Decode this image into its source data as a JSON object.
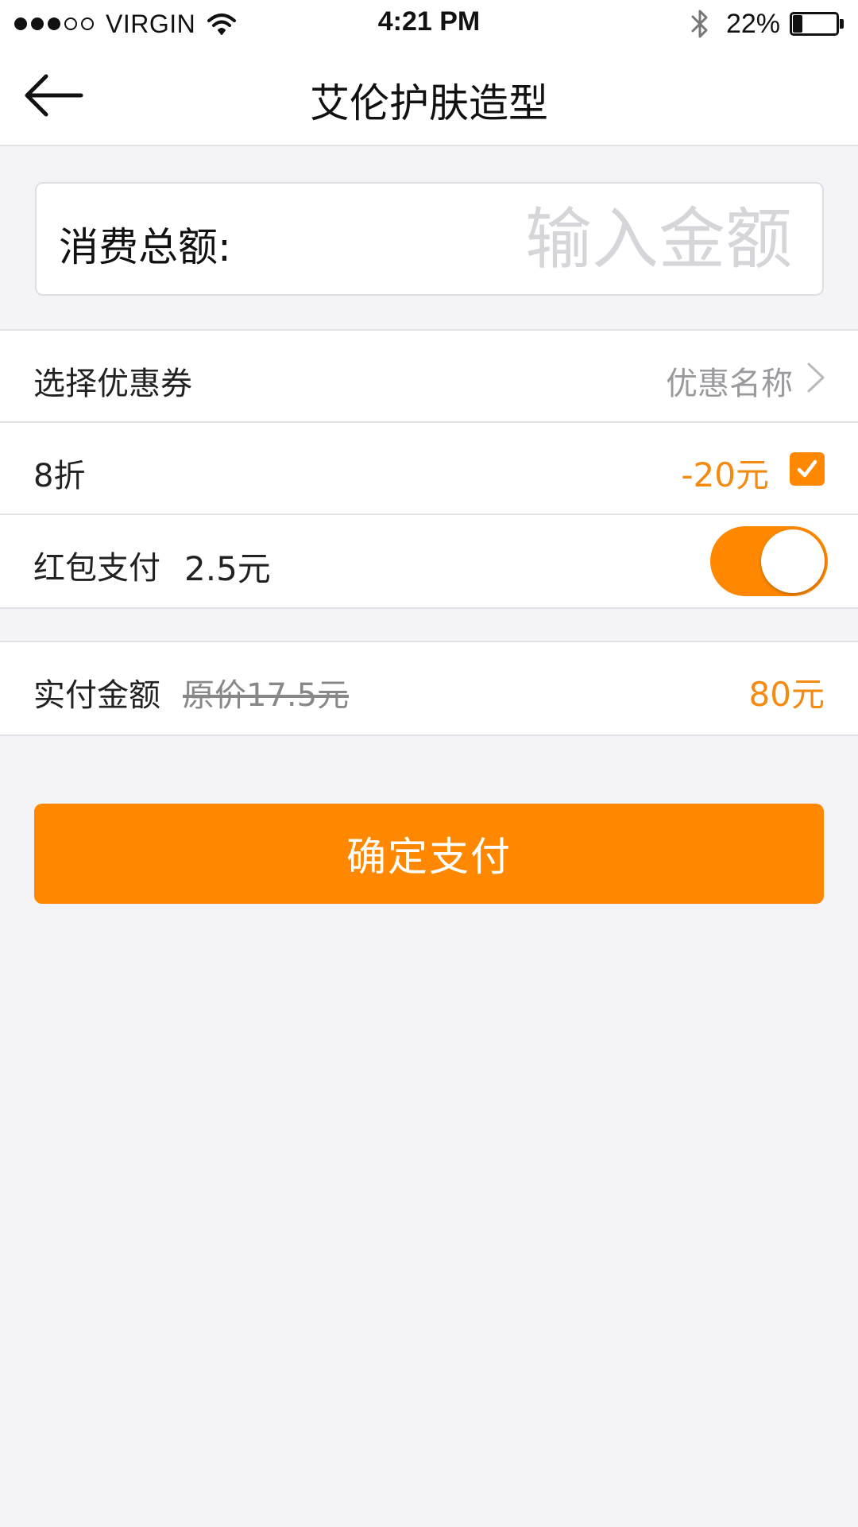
{
  "status_bar": {
    "carrier": "VIRGIN",
    "time": "4:21 PM",
    "battery_percent": "22%",
    "battery_level": 0.22,
    "signal_bars_filled": 3,
    "signal_bars_total": 5,
    "icons": [
      "wifi-icon",
      "bluetooth-icon",
      "battery-icon"
    ]
  },
  "nav": {
    "title": "艾伦护肤造型",
    "back_icon": "arrow-left-icon"
  },
  "amount": {
    "label": "消费总额:",
    "placeholder": "输入金额",
    "value": ""
  },
  "options": {
    "coupon": {
      "label": "选择优惠券",
      "value": "优惠名称",
      "icon": "chevron-right-icon"
    },
    "discount": {
      "label": "8折",
      "amount": "-20元",
      "checked": true
    },
    "red_packet": {
      "label": "红包支付",
      "amount": "2.5元",
      "enabled": true
    }
  },
  "summary": {
    "label": "实付金额",
    "original_price": "原价17.5元",
    "total": "80元"
  },
  "confirm": {
    "label": "确定支付"
  },
  "colors": {
    "accent": "#ff8800",
    "accent_text": "#f58a10",
    "background": "#f3f3f8",
    "placeholder": "#d6d6da",
    "secondary_text": "#9a9a9e"
  }
}
